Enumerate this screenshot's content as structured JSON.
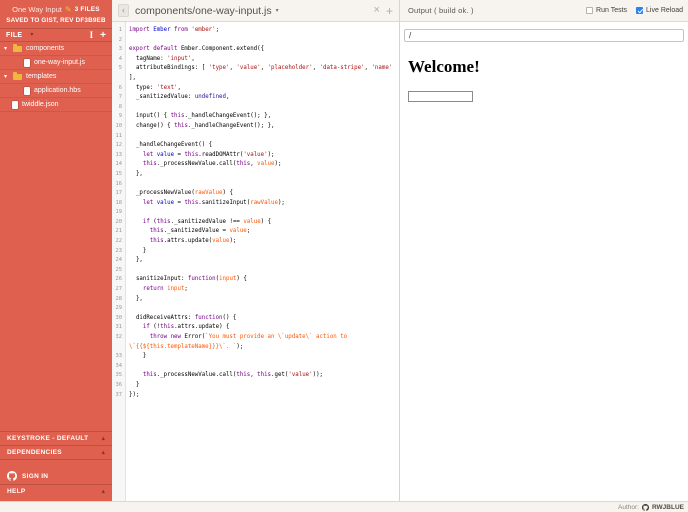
{
  "colors": {
    "sidebar_bg": "#df604e",
    "pencil": "#f0c330",
    "folder_icon": "#efb73e",
    "header_bg": "#f7f3ee",
    "header_border": "#ddd8d2",
    "accent_checkbox": "#2f80e8",
    "gutter_text": "#999999",
    "code_text": "#000000",
    "code_keyword": "#770088",
    "code_def": "#0000cc",
    "code_string": "#aa1111",
    "code_string2": "#ff5500",
    "code_atom": "#221199",
    "code_variable": "#ff5500"
  },
  "icons": {
    "pencil": "✎",
    "caret_down": "▾",
    "caret_up": "▴",
    "chevron_left": "‹",
    "close": "×",
    "add": "+",
    "text_tool": "I"
  },
  "sidebar": {
    "gist_title": "One Way Input",
    "files_badge": "3 FILES",
    "saved_status": "SAVED TO GIST, REV DF3B9EB",
    "file_menu_label": "FILE",
    "tree": [
      {
        "label": "components",
        "type": "folder",
        "depth": 0
      },
      {
        "label": "one-way-input.js",
        "type": "file",
        "depth": 1
      },
      {
        "label": "templates",
        "type": "folder",
        "depth": 0
      },
      {
        "label": "application.hbs",
        "type": "file",
        "depth": 1
      },
      {
        "label": "twiddle.json",
        "type": "file",
        "depth": 0
      }
    ],
    "bottom_menus": [
      {
        "label": "KEYSTROKE - DEFAULT"
      },
      {
        "label": "DEPENDENCIES"
      }
    ],
    "sign_in_label": "SIGN IN",
    "help_label": "HELP"
  },
  "editor": {
    "tab_title": "components/one-way-input.js",
    "code_lines": [
      "import Ember from 'ember';",
      "",
      "export default Ember.Component.extend({",
      "  tagName: 'input',",
      "  attributeBindings: [ 'type', 'value', 'placeholder', 'data-stripe', 'name' ],",
      "  type: 'text',",
      "  _sanitizedValue: undefined,",
      "",
      "  input() { this._handleChangeEvent(); },",
      "  change() { this._handleChangeEvent(); },",
      "",
      "  _handleChangeEvent() {",
      "    let value = this.readDOMAttr('value');",
      "    this._processNewValue.call(this, value);",
      "  },",
      "",
      "  _processNewValue(rawValue) {",
      "    let value = this.sanitizeInput(rawValue);",
      "",
      "    if (this._sanitizedValue !== value) {",
      "      this._sanitizedValue = value;",
      "      this.attrs.update(value);",
      "    }",
      "  },",
      "",
      "  sanitizeInput: function(input) {",
      "    return input;",
      "  },",
      "",
      "  didReceiveAttrs: function() {",
      "    if (!this.attrs.update) {",
      "      throw new Error(`You must provide an \\`update\\` action to \\`{{${this.templateName}}}\\`. `);",
      "    }",
      "",
      "    this._processNewValue.call(this, this.get('value'));",
      "  }",
      "});"
    ],
    "highlight": {
      "keywords": [
        "import",
        "export",
        "default",
        "from",
        "let",
        "if",
        "return",
        "function",
        "throw",
        "new",
        "this"
      ],
      "atoms": [
        "undefined"
      ],
      "local_vars": [
        "value",
        "rawValue",
        "input"
      ]
    }
  },
  "output": {
    "header_label": "Output ( build ok. )",
    "run_tests_label": "Run Tests",
    "run_tests_checked": false,
    "live_reload_label": "Live Reload",
    "live_reload_checked": true,
    "url_value": "/",
    "preview_heading": "Welcome!",
    "preview_input_value": ""
  },
  "footer": {
    "author_label": "Author:",
    "author_name": "RWJBLUE"
  }
}
